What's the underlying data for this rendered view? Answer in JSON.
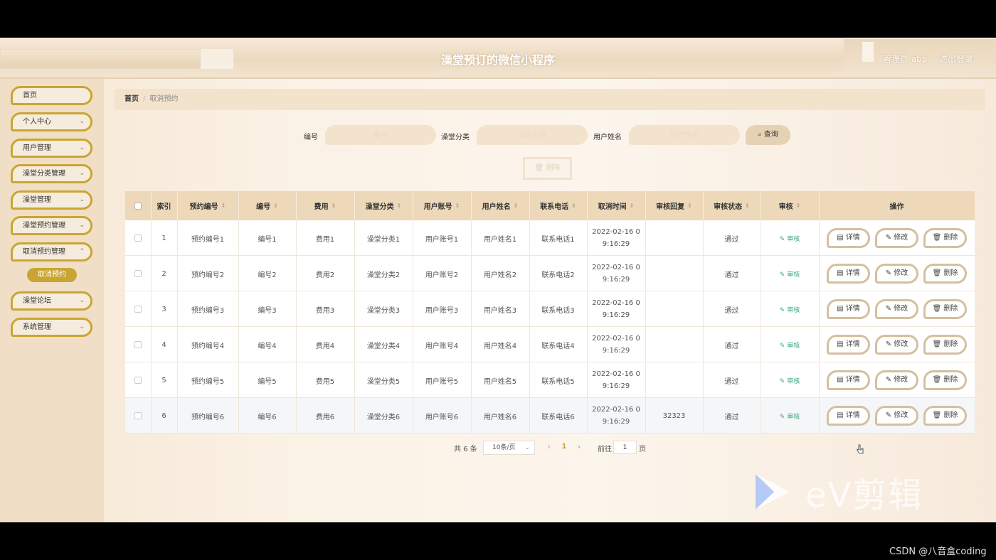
{
  "header": {
    "title": "澡堂预订的微信小程序",
    "user": "管理员 abo",
    "logout": "退出登录"
  },
  "sidebar": {
    "items": [
      {
        "label": "首页"
      },
      {
        "label": "个人中心"
      },
      {
        "label": "用户管理"
      },
      {
        "label": "澡堂分类管理"
      },
      {
        "label": "澡堂管理"
      },
      {
        "label": "澡堂预约管理"
      },
      {
        "label": "取消预约管理"
      },
      {
        "label": "澡堂论坛"
      },
      {
        "label": "系统管理"
      }
    ],
    "active_sub": "取消预约"
  },
  "breadcrumb": {
    "home": "首页",
    "sep": "/",
    "current": "取消预约"
  },
  "search": {
    "f1_label": "编号",
    "f1_placeholder": "编号",
    "f2_label": "澡堂分类",
    "f2_placeholder": "澡堂分类",
    "f3_label": "用户姓名",
    "f3_placeholder": "用户姓名",
    "button": "查询"
  },
  "bulk_delete": "删除",
  "table": {
    "headers": [
      "索引",
      "预约编号",
      "编号",
      "费用",
      "澡堂分类",
      "用户账号",
      "用户姓名",
      "联系电话",
      "取消时间",
      "审核回复",
      "审核状态",
      "审核",
      "操作"
    ],
    "rows": [
      {
        "idx": "1",
        "booking": "预约编号1",
        "code": "编号1",
        "fee": "费用1",
        "cat": "澡堂分类1",
        "acct": "用户账号1",
        "name": "用户姓名1",
        "phone": "联系电话1",
        "time1": "2022-02-16 0",
        "time2": "9:16:29",
        "reply": "",
        "status": "通过",
        "audit": "审核"
      },
      {
        "idx": "2",
        "booking": "预约编号2",
        "code": "编号2",
        "fee": "费用2",
        "cat": "澡堂分类2",
        "acct": "用户账号2",
        "name": "用户姓名2",
        "phone": "联系电话2",
        "time1": "2022-02-16 0",
        "time2": "9:16:29",
        "reply": "",
        "status": "通过",
        "audit": "审核"
      },
      {
        "idx": "3",
        "booking": "预约编号3",
        "code": "编号3",
        "fee": "费用3",
        "cat": "澡堂分类3",
        "acct": "用户账号3",
        "name": "用户姓名3",
        "phone": "联系电话3",
        "time1": "2022-02-16 0",
        "time2": "9:16:29",
        "reply": "",
        "status": "通过",
        "audit": "审核"
      },
      {
        "idx": "4",
        "booking": "预约编号4",
        "code": "编号4",
        "fee": "费用4",
        "cat": "澡堂分类4",
        "acct": "用户账号4",
        "name": "用户姓名4",
        "phone": "联系电话4",
        "time1": "2022-02-16 0",
        "time2": "9:16:29",
        "reply": "",
        "status": "通过",
        "audit": "审核"
      },
      {
        "idx": "5",
        "booking": "预约编号5",
        "code": "编号5",
        "fee": "费用5",
        "cat": "澡堂分类5",
        "acct": "用户账号5",
        "name": "用户姓名5",
        "phone": "联系电话5",
        "time1": "2022-02-16 0",
        "time2": "9:16:29",
        "reply": "",
        "status": "通过",
        "audit": "审核"
      },
      {
        "idx": "6",
        "booking": "预约编号6",
        "code": "编号6",
        "fee": "费用6",
        "cat": "澡堂分类6",
        "acct": "用户账号6",
        "name": "用户姓名6",
        "phone": "联系电话6",
        "time1": "2022-02-16 0",
        "time2": "9:16:29",
        "reply": "32323",
        "status": "通过",
        "audit": "审核"
      }
    ],
    "actions": {
      "detail": "详情",
      "edit": "修改",
      "delete": "删除"
    }
  },
  "pagination": {
    "total": "共 6 条",
    "page_size": "10条/页",
    "current": "1",
    "goto_label": "前往",
    "goto_value": "1",
    "page_suffix": "页"
  },
  "watermark": {
    "ev": "eV剪辑",
    "csdn": "CSDN @八音盒coding"
  },
  "colors": {
    "accent": "#c9a533",
    "header_bg": "#edd8ba",
    "audit": "#3aa87a"
  }
}
